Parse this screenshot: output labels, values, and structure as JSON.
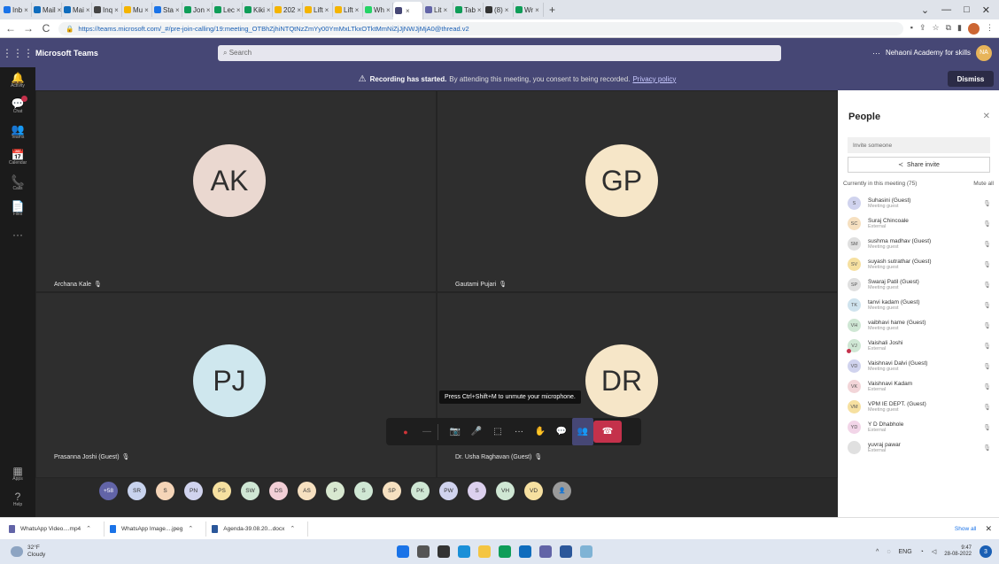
{
  "browser": {
    "tabs": [
      {
        "label": "Inb",
        "color": "#1a73e8"
      },
      {
        "label": "Mail",
        "color": "#0f6cbd"
      },
      {
        "label": "Mai",
        "color": "#0f6cbd"
      },
      {
        "label": "Inq",
        "color": "#444"
      },
      {
        "label": "Mu",
        "color": "#f4b400"
      },
      {
        "label": "Sta",
        "color": "#1a73e8"
      },
      {
        "label": "Jon",
        "color": "#0f9d58"
      },
      {
        "label": "Lec",
        "color": "#0f9d58"
      },
      {
        "label": "Kiki",
        "color": "#0f9d58"
      },
      {
        "label": "202",
        "color": "#f4b400"
      },
      {
        "label": "Lift",
        "color": "#f4b400"
      },
      {
        "label": "Lift",
        "color": "#f4b400"
      },
      {
        "label": "Wh",
        "color": "#25d366"
      },
      {
        "label": "",
        "color": "#464775"
      },
      {
        "label": "Lit",
        "color": "#6264a7"
      },
      {
        "label": "Tab",
        "color": "#0f9d58"
      },
      {
        "label": "(8)",
        "color": "#333"
      },
      {
        "label": "Wr",
        "color": "#0f9d58"
      }
    ],
    "new_tab": "+",
    "window_controls": {
      "minimize": "—",
      "maximize": "□",
      "close": "✕",
      "dropdown": "⌄"
    },
    "nav": {
      "back": "←",
      "forward": "→",
      "reload": "C"
    },
    "url": "https://teams.microsoft.com/_#/pre-join-calling/19:meeting_OTBhZjhiNTQtNzZmYy00YmMxLTkxOTktMmNiZjJjNWJjMjA0@thread.v2"
  },
  "teams": {
    "app_name": "Microsoft Teams",
    "search_placeholder": "Search",
    "account_name": "Nehaoni Academy for skills",
    "account_initials": "NA",
    "more": "···"
  },
  "rail": {
    "items": [
      {
        "icon": "bell-icon",
        "glyph": "🔔",
        "label": "Activity",
        "badge": false
      },
      {
        "icon": "chat-icon",
        "glyph": "💬",
        "label": "Chat",
        "badge": true
      },
      {
        "icon": "teams-icon",
        "glyph": "👥",
        "label": "Teams",
        "badge": false
      },
      {
        "icon": "calendar-icon",
        "glyph": "📅",
        "label": "Calendar",
        "badge": false
      },
      {
        "icon": "calls-icon",
        "glyph": "📞",
        "label": "Calls",
        "badge": false
      },
      {
        "icon": "files-icon",
        "glyph": "📄",
        "label": "Files",
        "badge": false
      },
      {
        "icon": "more-icon",
        "glyph": "···",
        "label": "",
        "badge": false
      }
    ],
    "bottom": [
      {
        "icon": "apps-icon",
        "glyph": "▦",
        "label": "Apps"
      },
      {
        "icon": "help-icon",
        "glyph": "?",
        "label": "Help"
      }
    ]
  },
  "banner": {
    "warning_icon": "⚠",
    "bold": "Recording has started.",
    "text": "By attending this meeting, you consent to being recorded.",
    "link": "Privacy policy",
    "dismiss": "Dismiss"
  },
  "stage": {
    "tiles": [
      {
        "initials": "AK",
        "name": "Archana Kale",
        "color": "#ead8d0"
      },
      {
        "initials": "GP",
        "name": "Gautami Pujari",
        "color": "#f6e6c8"
      },
      {
        "initials": "PJ",
        "name": "Prasanna Joshi (Guest)",
        "color": "#cfe7ee"
      },
      {
        "initials": "DR",
        "name": "Dr. Usha Raghavan (Guest)",
        "color": "#f6e6c8"
      }
    ],
    "tooltip": "Press Ctrl+Shift+M to unmute your microphone.",
    "gallery": [
      {
        "label": "+58",
        "color": "#6264a7"
      },
      {
        "label": "SR",
        "color": "#c8d3ee"
      },
      {
        "label": "S",
        "color": "#f5d5b8"
      },
      {
        "label": "PN",
        "color": "#d0d3ee"
      },
      {
        "label": "PS",
        "color": "#f6e0a0"
      },
      {
        "label": "SW",
        "color": "#cfe7d4"
      },
      {
        "label": "DS",
        "color": "#f2cfd6"
      },
      {
        "label": "AS",
        "color": "#f6e0c0"
      },
      {
        "label": "P",
        "color": "#d8e8d0"
      },
      {
        "label": "S",
        "color": "#cfe7d4"
      },
      {
        "label": "SP",
        "color": "#f6e0c0"
      },
      {
        "label": "PK",
        "color": "#cfe7d4"
      },
      {
        "label": "PW",
        "color": "#d0d3ee"
      },
      {
        "label": "S",
        "color": "#dcd0ee"
      },
      {
        "label": "VH",
        "color": "#cfe7d4"
      },
      {
        "label": "VD",
        "color": "#f6e0a0"
      },
      {
        "label": "",
        "color": "#9a9a9a"
      }
    ]
  },
  "controls": {
    "record": "●",
    "timer": "—",
    "camera": "📷",
    "mic": "🎤",
    "share": "⬚",
    "more": "···",
    "raise_hand": "✋",
    "chat": "💬",
    "people": "👥",
    "hangup": "☎"
  },
  "people": {
    "title": "People",
    "close": "✕",
    "invite_placeholder": "Invite someone",
    "share_invite": "Share invite",
    "current_label": "Currently in this meeting (75)",
    "mute_all": "Mute all",
    "list": [
      {
        "initials": "S",
        "name": "Suhasini (Guest)",
        "sub": "Meeting guest",
        "color": "#d0d3ee",
        "red": false
      },
      {
        "initials": "SC",
        "name": "Suraj Chincoale",
        "sub": "External",
        "color": "#f6e0c0",
        "red": false
      },
      {
        "initials": "SM",
        "name": "sushma madhav (Guest)",
        "sub": "Meeting guest",
        "color": "#e0e0e0",
        "red": false
      },
      {
        "initials": "SV",
        "name": "suyash sutrathar (Guest)",
        "sub": "Meeting guest",
        "color": "#f6e0a0",
        "red": false
      },
      {
        "initials": "SP",
        "name": "Swaraj Patil (Guest)",
        "sub": "Meeting guest",
        "color": "#e0e0e0",
        "red": false
      },
      {
        "initials": "TK",
        "name": "tanvi kadam (Guest)",
        "sub": "Meeting guest",
        "color": "#cfe3ee",
        "red": false
      },
      {
        "initials": "VH",
        "name": "vaibhavi hame (Guest)",
        "sub": "Meeting guest",
        "color": "#cfe7d4",
        "red": false
      },
      {
        "initials": "VJ",
        "name": "Vaishali Joshi",
        "sub": "External",
        "color": "#cfe7d4",
        "red": true
      },
      {
        "initials": "VD",
        "name": "Vaishnavi Dalvi (Guest)",
        "sub": "Meeting guest",
        "color": "#d0d3ee",
        "red": false
      },
      {
        "initials": "VK",
        "name": "Vaishnavi Kadam",
        "sub": "External",
        "color": "#f2d5d8",
        "red": false
      },
      {
        "initials": "VM",
        "name": "VPM IE DEPT. (Guest)",
        "sub": "Meeting guest",
        "color": "#f6e0a0",
        "red": false
      },
      {
        "initials": "YD",
        "name": "Y D Dhabhole",
        "sub": "External",
        "color": "#f2d5e8",
        "red": false
      },
      {
        "initials": "",
        "name": "yuvraj pawar",
        "sub": "External",
        "color": "#e0e0e0",
        "red": false
      }
    ]
  },
  "downloads": {
    "items": [
      {
        "name": "WhatsApp Video....mp4",
        "color": "#6264a7"
      },
      {
        "name": "WhatsApp Image....jpeg",
        "color": "#1a73e8"
      },
      {
        "name": "Agenda-39.08.20...docx",
        "color": "#2b579a"
      }
    ],
    "show_all": "Show all",
    "close": "✕"
  },
  "taskbar": {
    "temp": "32°F",
    "condition": "Cloudy",
    "apps": [
      {
        "icon": "start-icon",
        "color": "#1a73e8"
      },
      {
        "icon": "search-icon",
        "color": "#555"
      },
      {
        "icon": "taskview-icon",
        "color": "#333"
      },
      {
        "icon": "edge-icon",
        "color": "#1a8fd8"
      },
      {
        "icon": "explorer-icon",
        "color": "#f4c542"
      },
      {
        "icon": "chrome-icon",
        "color": "#0f9d58"
      },
      {
        "icon": "store-icon",
        "color": "#0f6cbd"
      },
      {
        "icon": "teams-icon",
        "color": "#6264a7"
      },
      {
        "icon": "word-icon",
        "color": "#2b579a"
      },
      {
        "icon": "notes-icon",
        "color": "#7fb3d5"
      }
    ],
    "lang": "ENG",
    "lang2": "IN",
    "time": "9:47",
    "date": "28-08-2022",
    "notifications": "3"
  }
}
